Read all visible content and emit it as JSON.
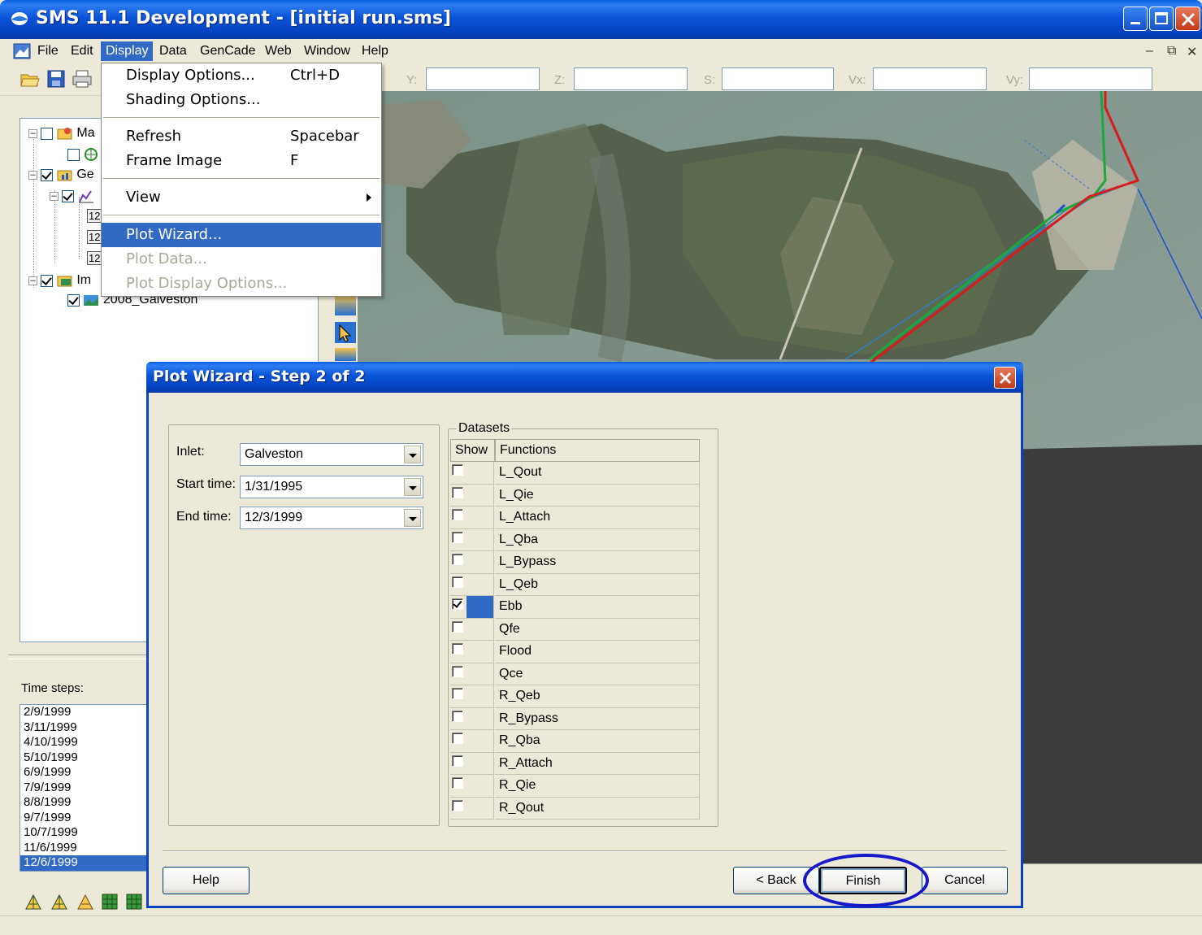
{
  "window": {
    "title": "SMS 11.1 Development - [initial run.sms]"
  },
  "menubar": {
    "items": [
      "File",
      "Edit",
      "Display",
      "Data",
      "GenCade",
      "Web",
      "Window",
      "Help"
    ],
    "active": "Display"
  },
  "toolbar": {
    "coords": [
      {
        "label": "Y:"
      },
      {
        "label": "Z:"
      },
      {
        "label": "S:"
      },
      {
        "label": "Vx:"
      },
      {
        "label": "Vy:"
      }
    ]
  },
  "display_menu": {
    "items": [
      {
        "label": "Display Options...",
        "shortcut": "Ctrl+D"
      },
      {
        "label": "Shading Options...",
        "shortcut": ""
      },
      {
        "label": "Refresh",
        "shortcut": "Spacebar"
      },
      {
        "label": "Frame Image",
        "shortcut": "F"
      },
      {
        "label": "View",
        "shortcut": ""
      },
      {
        "label": "Plot Wizard...",
        "shortcut": ""
      },
      {
        "label": "Plot Data...",
        "shortcut": ""
      },
      {
        "label": "Plot Display Options...",
        "shortcut": ""
      }
    ],
    "highlighted": "Plot Wizard...",
    "disabled": [
      "Plot Data...",
      "Plot Display Options..."
    ]
  },
  "tree": {
    "rows": [
      {
        "text": "Ma"
      },
      {
        "text": ""
      },
      {
        "text": "Ge"
      },
      {
        "text": ""
      },
      {
        "text": "12"
      },
      {
        "text": "12"
      },
      {
        "text": "12"
      },
      {
        "text": "Im"
      },
      {
        "text": "2008_Galveston"
      }
    ]
  },
  "time_steps": {
    "label": "Time steps:",
    "items": [
      "2/9/1999",
      "3/11/1999",
      "4/10/1999",
      "5/10/1999",
      "6/9/1999",
      "7/9/1999",
      "8/8/1999",
      "9/7/1999",
      "10/7/1999",
      "11/6/1999",
      "12/6/1999"
    ],
    "selected": "12/6/1999"
  },
  "dialog": {
    "title": "Plot Wizard - Step 2 of 2",
    "inlet_label": "Inlet:",
    "inlet_value": "Galveston",
    "start_label": "Start time:",
    "start_value": "1/31/1995",
    "end_label": "End time:",
    "end_value": "12/3/1999",
    "datasets_label": "Datasets",
    "col_show": "Show",
    "col_functions": "Functions",
    "rows": [
      {
        "name": "L_Qout",
        "checked": false
      },
      {
        "name": "L_Qie",
        "checked": false
      },
      {
        "name": "L_Attach",
        "checked": false
      },
      {
        "name": "L_Qba",
        "checked": false
      },
      {
        "name": "L_Bypass",
        "checked": false
      },
      {
        "name": "L_Qeb",
        "checked": false
      },
      {
        "name": "Ebb",
        "checked": true
      },
      {
        "name": "Qfe",
        "checked": false
      },
      {
        "name": "Flood",
        "checked": false
      },
      {
        "name": "Qce",
        "checked": false
      },
      {
        "name": "R_Qeb",
        "checked": false
      },
      {
        "name": "R_Bypass",
        "checked": false
      },
      {
        "name": "R_Qba",
        "checked": false
      },
      {
        "name": "R_Attach",
        "checked": false
      },
      {
        "name": "R_Qie",
        "checked": false
      },
      {
        "name": "R_Qout",
        "checked": false
      }
    ],
    "buttons": {
      "help": "Help",
      "back": "< Back",
      "finish": "Finish",
      "cancel": "Cancel"
    }
  },
  "colors": {
    "title_blue": "#0A54D8",
    "selection": "#316AC5",
    "highlight_ring": "#1818C8"
  }
}
